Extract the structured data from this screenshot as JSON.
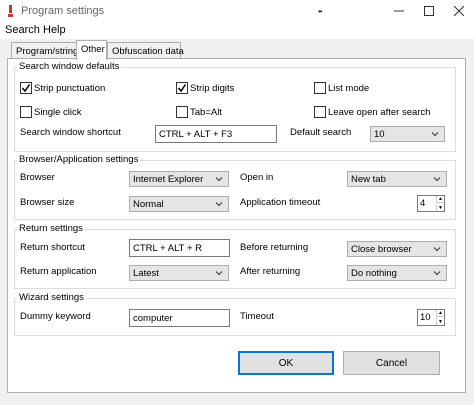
{
  "window": {
    "title": "Program settings"
  },
  "menu": {
    "items": [
      "Search",
      "Help"
    ]
  },
  "tabs": [
    "Program/string",
    "Other",
    "Obfuscation data"
  ],
  "search_defaults": {
    "title": "Search window defaults",
    "strip_punctuation": {
      "label": "Strip punctuation",
      "checked": true
    },
    "strip_digits": {
      "label": "Strip digits",
      "checked": true
    },
    "list_mode": {
      "label": "List mode",
      "checked": false
    },
    "single_click": {
      "label": "Single click",
      "checked": false
    },
    "tab_alt": {
      "label": "Tab=Alt",
      "checked": false
    },
    "leave_open": {
      "label": "Leave open after search",
      "checked": false
    },
    "shortcut_label": "Search window shortcut",
    "shortcut_value": "CTRL + ALT + F3",
    "default_search_label": "Default search",
    "default_search_value": "10"
  },
  "browser": {
    "title": "Browser/Application settings",
    "browser_label": "Browser",
    "browser_value": "Internet Explorer",
    "open_in_label": "Open in",
    "open_in_value": "New tab",
    "size_label": "Browser size",
    "size_value": "Normal",
    "timeout_label": "Application timeout",
    "timeout_value": "4"
  },
  "return_settings": {
    "title": "Return settings",
    "shortcut_label": "Return shortcut",
    "shortcut_value": "CTRL + ALT + R",
    "before_label": "Before returning",
    "before_value": "Close browser",
    "app_label": "Return application",
    "app_value": "Latest",
    "after_label": "After returning",
    "after_value": "Do nothing"
  },
  "wizard": {
    "title": "Wizard settings",
    "dummy_label": "Dummy keyword",
    "dummy_value": "computer",
    "timeout_label": "Timeout",
    "timeout_value": "10"
  },
  "buttons": {
    "ok": "OK",
    "cancel": "Cancel"
  },
  "colors": {
    "accent": "#0078d7",
    "app_icon": "#c0392b"
  }
}
